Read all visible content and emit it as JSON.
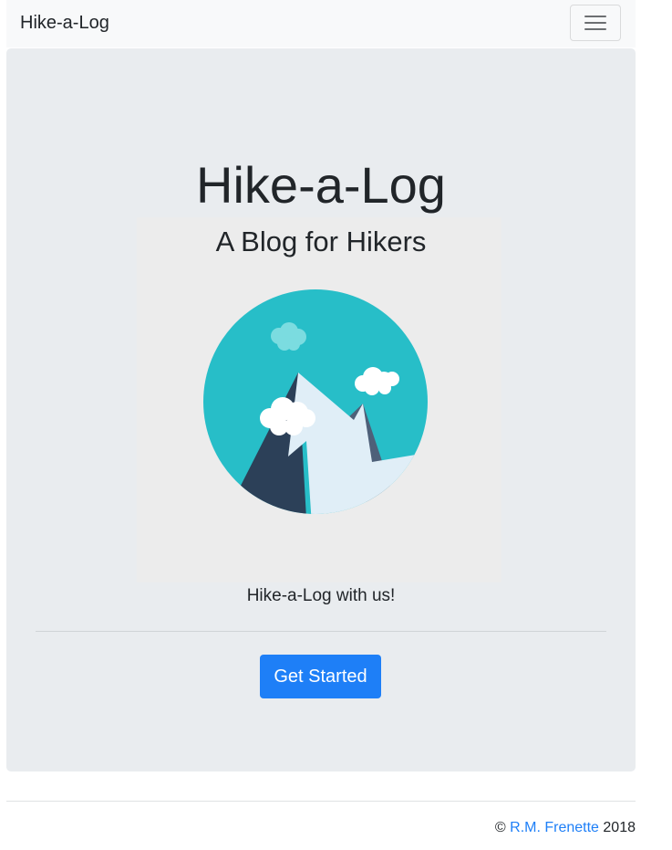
{
  "navbar": {
    "brand": "Hike-a-Log",
    "toggler_icon": "hamburger-menu-icon"
  },
  "hero": {
    "title": "Hike-a-Log",
    "subtitle": "A Blog for Hikers",
    "image_icon": "mountain-landscape-icon",
    "tagline": "Hike-a-Log with us!",
    "cta_label": "Get Started"
  },
  "footer": {
    "copyright_symbol": "©",
    "author_link": "R.M. Frenette",
    "year": "2018"
  },
  "colors": {
    "navbar_bg": "#f8f9fa",
    "jumbotron_bg": "#e9ecef",
    "primary": "#1e7ff7",
    "sky": "#27bec8",
    "mountain_dark": "#2c4058",
    "mountain_light": "#e0eef7"
  }
}
